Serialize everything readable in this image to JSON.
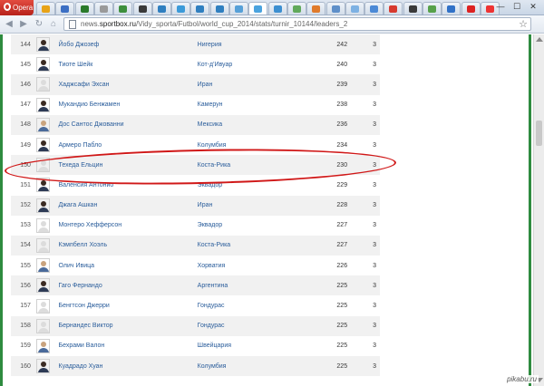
{
  "browser": {
    "name": "Opera",
    "url_prefix": "news.",
    "url_domain": "sportbox.ru",
    "url_path": "/Vidy_sporta/Futbol/world_cup_2014/stats/turnir_10144/leaders_2",
    "tab_colors": [
      "#e8a317",
      "#3c6fc4",
      "#2a7a2a",
      "#9a9a9a",
      "#3d8f3d",
      "#3a3a3a",
      "#2f7fc0",
      "#3b9ad9",
      "#2f7fc0",
      "#2f7fc0",
      "#56a0d8",
      "#4aa3df",
      "#3c8fd1",
      "#60a95b",
      "#e07b2c",
      "#5e8fc9",
      "#7db1e3",
      "#4b89d6",
      "#d73a2f",
      "#3a3a3a",
      "#57a14a",
      "#3071c7",
      "#d22",
      "#e33"
    ],
    "window_controls": [
      "—",
      "☐",
      "✕"
    ]
  },
  "table": {
    "rows": [
      {
        "rank": "144",
        "name": "Йобо Джозеф",
        "country": "Нигерия",
        "minutes": "242",
        "goals": "3",
        "photo": "dark"
      },
      {
        "rank": "145",
        "name": "Тиоте Шейк",
        "country": "Кот-д'Ивуар",
        "minutes": "240",
        "goals": "3",
        "photo": "dark"
      },
      {
        "rank": "146",
        "name": "Хаджсафи Эхсан",
        "country": "Иран",
        "minutes": "239",
        "goals": "3",
        "photo": "none"
      },
      {
        "rank": "147",
        "name": "Мукандио Бенжамен",
        "country": "Камерун",
        "minutes": "238",
        "goals": "3",
        "photo": "dark"
      },
      {
        "rank": "148",
        "name": "Дос Сантос Джованни",
        "country": "Мексика",
        "minutes": "236",
        "goals": "3",
        "photo": "light"
      },
      {
        "rank": "149",
        "name": "Армеро Пабло",
        "country": "Колумбия",
        "minutes": "234",
        "goals": "3",
        "photo": "dark"
      },
      {
        "rank": "150",
        "name": "Техеда Ельцин",
        "country": "Коста-Рика",
        "minutes": "230",
        "goals": "3",
        "photo": "none"
      },
      {
        "rank": "151",
        "name": "Валенсия Антонио",
        "country": "Эквадор",
        "minutes": "229",
        "goals": "3",
        "photo": "dark"
      },
      {
        "rank": "152",
        "name": "Джага Ашкан",
        "country": "Иран",
        "minutes": "228",
        "goals": "3",
        "photo": "dark"
      },
      {
        "rank": "153",
        "name": "Монтеро Хефферсон",
        "country": "Эквадор",
        "minutes": "227",
        "goals": "3",
        "photo": "none"
      },
      {
        "rank": "154",
        "name": "Кэмпбелл Хоэль",
        "country": "Коста-Рика",
        "minutes": "227",
        "goals": "3",
        "photo": "none"
      },
      {
        "rank": "155",
        "name": "Олич Ивица",
        "country": "Хорватия",
        "minutes": "226",
        "goals": "3",
        "photo": "light"
      },
      {
        "rank": "156",
        "name": "Гаго Фернандо",
        "country": "Аргентина",
        "minutes": "225",
        "goals": "3",
        "photo": "dark"
      },
      {
        "rank": "157",
        "name": "Бенгтсон Джерри",
        "country": "Гондурас",
        "minutes": "225",
        "goals": "3",
        "photo": "none"
      },
      {
        "rank": "158",
        "name": "Бернандес Виктор",
        "country": "Гондурас",
        "minutes": "225",
        "goals": "3",
        "photo": "none"
      },
      {
        "rank": "159",
        "name": "Бехрами Валон",
        "country": "Швейцария",
        "minutes": "225",
        "goals": "3",
        "photo": "light"
      },
      {
        "rank": "160",
        "name": "Куадрадо Хуан",
        "country": "Колумбия",
        "minutes": "225",
        "goals": "3",
        "photo": "dark"
      }
    ],
    "highlighted_rank": "150",
    "highlight_color": "#d01818"
  },
  "watermark": "pikabu.ru"
}
